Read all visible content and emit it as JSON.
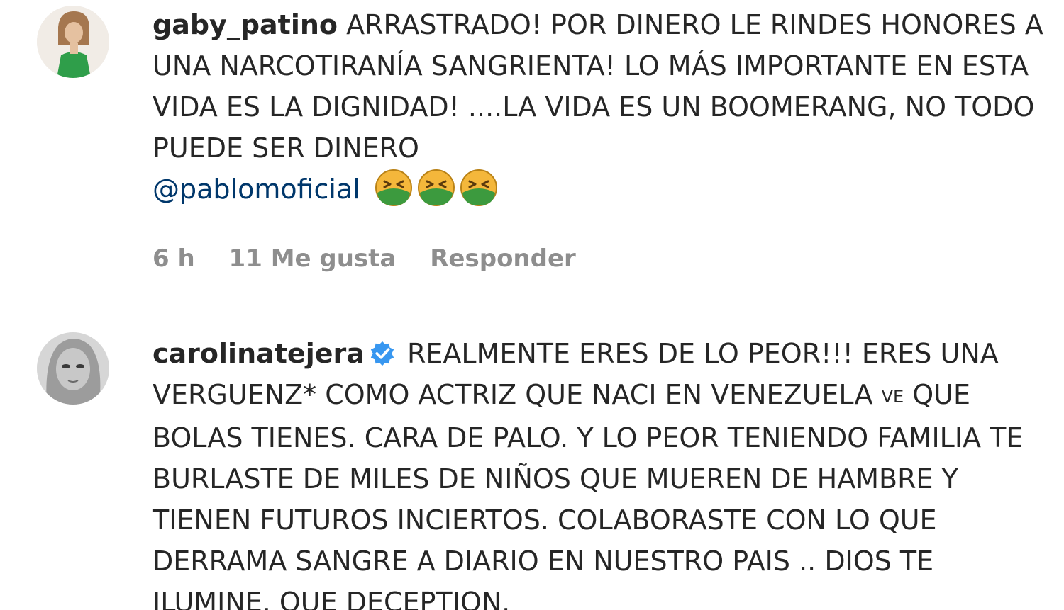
{
  "comments": [
    {
      "username": "gaby_patino",
      "text": "ARRASTRADO! POR DINERO LE RINDES HONORES A UNA NARCOTIRANÍA SANGRIENTA! LO MÁS IMPORTANTE EN ESTA VIDA ES LA DIGNIDAD! ....LA VIDA ES UN BOOMERANG, NO TODO PUEDE SER DINERO",
      "mention": "@pablomoficial",
      "emojis": [
        "nauseated-face-icon",
        "nauseated-face-icon",
        "nauseated-face-icon"
      ],
      "time": "6 h",
      "likes": "11 Me gusta",
      "reply_label": "Responder"
    },
    {
      "username": "carolinatejera",
      "verified": true,
      "text_part1": "REALMENTE ERES DE LO PEOR!!! ERES UNA VERGUENZ* COMO ACTRIZ QUE NACI EN VENEZUELA",
      "flag": "VE",
      "text_part2": "QUE BOLAS TIENES. CARA DE PALO. Y LO PEOR TENIENDO FAMILIA TE BURLASTE DE MILES DE NIÑOS QUE MUEREN DE HAMBRE Y TIENEN FUTUROS INCIERTOS. COLABORASTE CON LO QUE DERRAMA SANGRE A DIARIO EN NUESTRO PAIS .. DIOS TE ILUMINE. QUE DECEPTION."
    }
  ],
  "colors": {
    "text": "#262626",
    "meta": "#8e8e8e",
    "mention": "#00376b",
    "verified": "#3897f0"
  }
}
